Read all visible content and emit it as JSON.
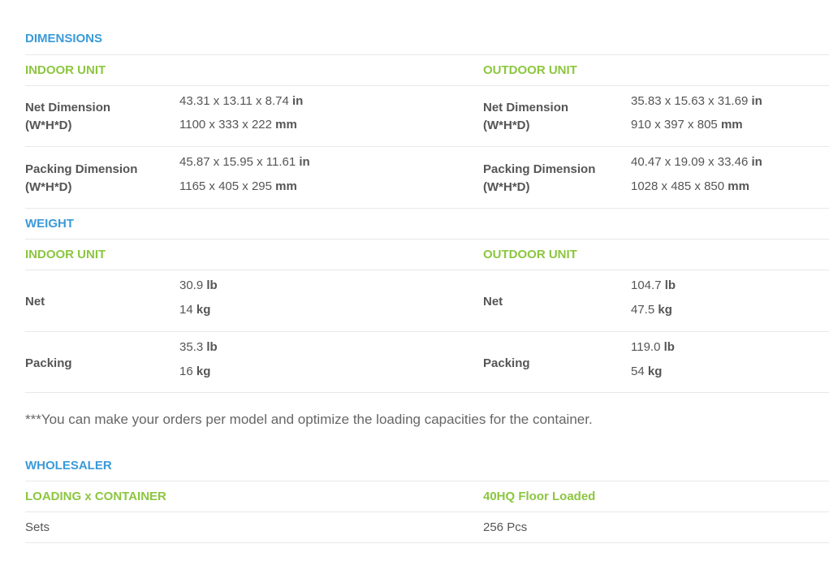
{
  "dimensions": {
    "heading": "DIMENSIONS",
    "indoor_heading": "INDOOR UNIT",
    "outdoor_heading": "OUTDOOR UNIT",
    "indoor": [
      {
        "label": "Net Dimension",
        "sub": "(W*H*D)",
        "v1": "43.31 x 13.11 x 8.74",
        "u1": "in",
        "v2": "1100 x 333 x 222",
        "u2": "mm"
      },
      {
        "label": "Packing Dimension",
        "sub": "(W*H*D)",
        "v1": "45.87 x 15.95 x 11.61",
        "u1": "in",
        "v2": "1165 x 405 x 295",
        "u2": "mm"
      }
    ],
    "outdoor": [
      {
        "label": "Net Dimension",
        "sub": "(W*H*D)",
        "v1": "35.83 x 15.63 x 31.69",
        "u1": "in",
        "v2": "910 x 397 x 805",
        "u2": "mm"
      },
      {
        "label": "Packing Dimension",
        "sub": "(W*H*D)",
        "v1": "40.47 x 19.09 x 33.46",
        "u1": "in",
        "v2": "1028 x 485 x 850",
        "u2": "mm"
      }
    ]
  },
  "weight": {
    "heading": "WEIGHT",
    "indoor_heading": "INDOOR UNIT",
    "outdoor_heading": "OUTDOOR UNIT",
    "indoor": [
      {
        "label": "Net",
        "v1": "30.9",
        "u1": "lb",
        "v2": "14",
        "u2": "kg"
      },
      {
        "label": "Packing",
        "v1": "35.3",
        "u1": "lb",
        "v2": "16",
        "u2": "kg"
      }
    ],
    "outdoor": [
      {
        "label": "Net",
        "v1": "104.7",
        "u1": "lb",
        "v2": "47.5",
        "u2": "kg"
      },
      {
        "label": "Packing",
        "v1": "119.0",
        "u1": "lb",
        "v2": "54",
        "u2": "kg"
      }
    ]
  },
  "note": "***You can make your orders per model and optimize the loading capacities for the container.",
  "wholesaler": {
    "heading": "WHOLESALER",
    "col1_heading": "LOADING x CONTAINER",
    "col2_heading": "40HQ Floor Loaded",
    "row_label": "Sets",
    "row_value": "256 Pcs"
  },
  "colors": {
    "section_blue": "#3a9ad9",
    "subheading_green": "#8cc63f",
    "divider": "#e8e8e8"
  }
}
